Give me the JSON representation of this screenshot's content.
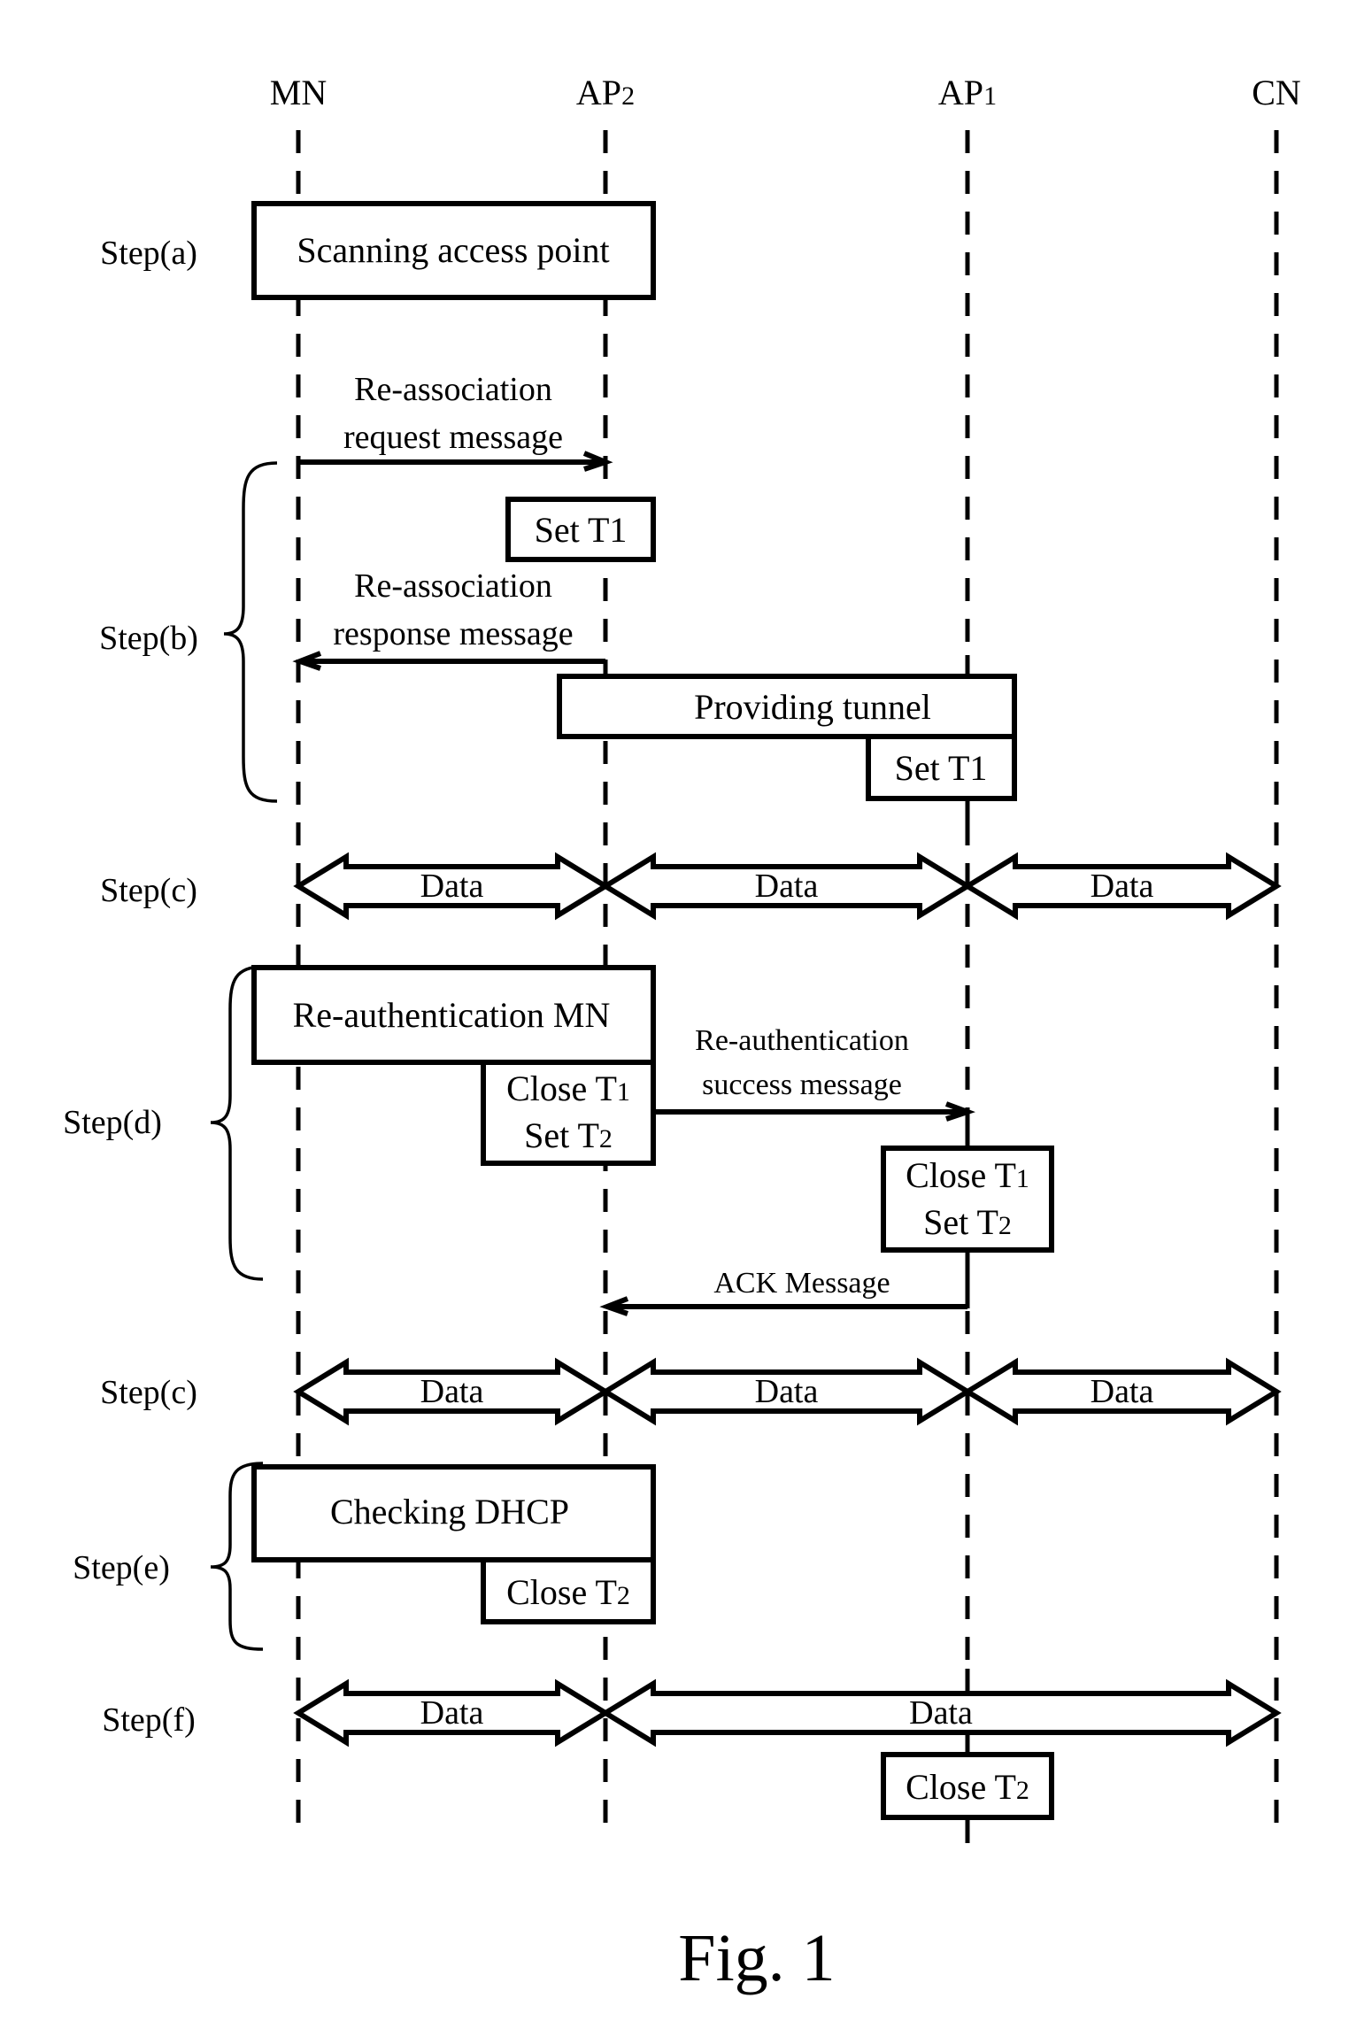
{
  "figure": {
    "caption": "Fig. 1",
    "entities": [
      {
        "id": "MN",
        "label": "MN",
        "sub": ""
      },
      {
        "id": "AP2",
        "label": "AP",
        "sub": "2"
      },
      {
        "id": "AP1",
        "label": "AP",
        "sub": "1"
      },
      {
        "id": "CN",
        "label": "CN",
        "sub": ""
      }
    ],
    "steps": {
      "a": "Step(a)",
      "b": "Step(b)",
      "c1": "Step(c)",
      "d": "Step(d)",
      "c2": "Step(c)",
      "e": "Step(e)",
      "f": "Step(f)"
    },
    "boxes": {
      "scanning": "Scanning access point",
      "set_t1_ap2": "Set T1",
      "providing_tunnel": "Providing tunnel",
      "set_t1_ap1": "Set T1",
      "reauth_mn": "Re-authentication MN",
      "ap2_close_t1": "Close T",
      "ap2_close_t1_sub": "1",
      "ap2_set_t2": "Set T",
      "ap2_set_t2_sub": "2",
      "ap1_close_t1": "Close T",
      "ap1_close_t1_sub": "1",
      "ap1_set_t2": "Set T",
      "ap1_set_t2_sub": "2",
      "checking_dhcp": "Checking DHCP",
      "ap2_close_t2": "Close T",
      "ap2_close_t2_sub": "2",
      "ap1_close_t2": "Close T",
      "ap1_close_t2_sub": "2"
    },
    "messages": {
      "reassoc_req_1": "Re-association",
      "reassoc_req_2": "request message",
      "reassoc_resp_1": "Re-association",
      "reassoc_resp_2": "response message",
      "reauth_success_1": "Re-authentication",
      "reauth_success_2": "success message",
      "ack": "ACK Message"
    },
    "data_label": "Data"
  }
}
